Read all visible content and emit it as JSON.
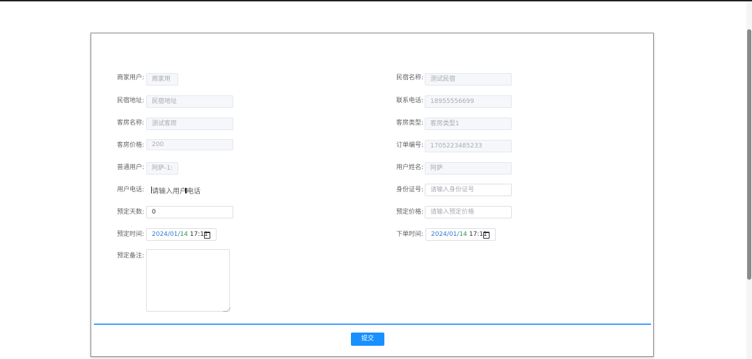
{
  "form": {
    "fields": [
      {
        "label": "商家用户:",
        "value": "商家用",
        "state": "disabled"
      },
      {
        "label": "民宿名称:",
        "value": "测试民宿",
        "state": "disabled"
      },
      {
        "label": "民宿地址:",
        "value": "民宿地址",
        "state": "disabled"
      },
      {
        "label": "联系电话:",
        "value": "18955556699",
        "state": "disabled"
      },
      {
        "label": "客房名称:",
        "value": "测试客房",
        "state": "disabled"
      },
      {
        "label": "客房类型:",
        "value": "客房类型1",
        "state": "disabled"
      },
      {
        "label": "客房价格:",
        "value": "200",
        "state": "disabled"
      },
      {
        "label": "订单编号:",
        "value": "1705223485233",
        "state": "disabled"
      },
      {
        "label": "普通用户:",
        "value": "阿萨-1:",
        "state": "disabled"
      },
      {
        "label": "用户姓名:",
        "value": "阿萨",
        "state": "disabled"
      },
      {
        "label": "用户电话:",
        "placeholder": "请输入用户电话",
        "state": "active"
      },
      {
        "label": "身份证号:",
        "placeholder": "请输入身份证号",
        "state": "empty"
      },
      {
        "label": "预定天数:",
        "value": "0",
        "state": "filled"
      },
      {
        "label": "预定价格:",
        "placeholder": "请输入预定价格",
        "state": "empty"
      },
      {
        "label": "预定时间:",
        "date": {
          "year": "2024",
          "month": "01",
          "day": "14",
          "time": "17:11"
        }
      },
      {
        "label": "下单时间:",
        "date": {
          "year": "2024",
          "month": "01",
          "day": "14",
          "time": "17:11"
        }
      },
      {
        "label": "预定备注:",
        "value": ""
      }
    ],
    "sep": "/",
    "submit_label": "提交"
  },
  "colors": {
    "accent": "#409eff",
    "button": "#1890ff",
    "label": "#606266",
    "date_year": "#2f7bd6",
    "date_day": "#2a9b4a"
  },
  "icons": [
    "calendar-icon",
    "calendar-icon",
    "text-cursor-icon"
  ]
}
